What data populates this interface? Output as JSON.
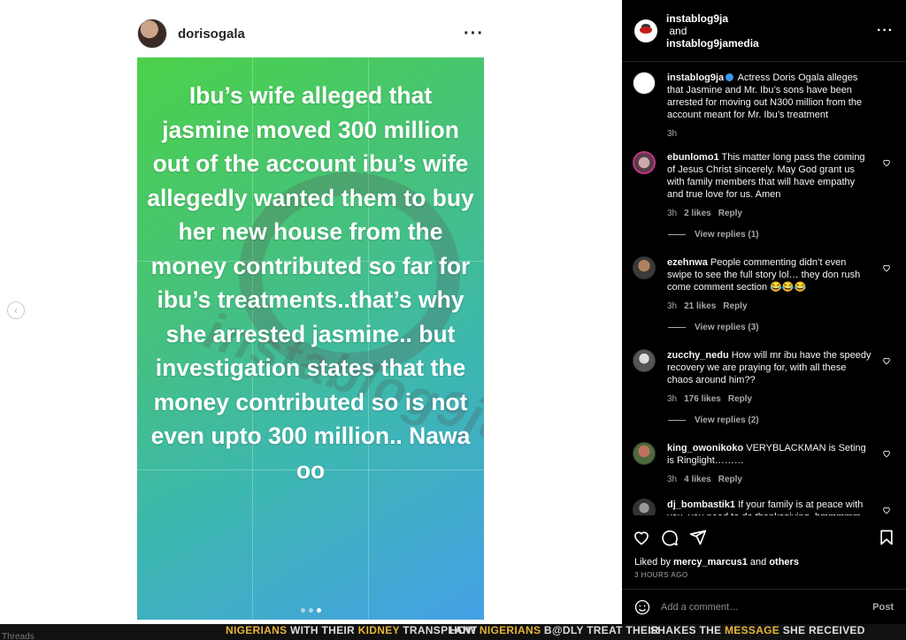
{
  "post": {
    "username": "dorisogala",
    "image_text": "Ibu’s wife alleged that jasmine moved 300 million out of the account ibu’s wife allegedly wanted them to buy her new house from the money contributed so far for ibu’s treatments..that’s why she arrested jasmine.. but investigation states that the money contributed so is not even upto 300 million.. Nawa oo",
    "watermark": "instablog9ja",
    "carousel": {
      "count": 3,
      "active": 3
    }
  },
  "panel": {
    "account1": "instablog9ja",
    "and": "and",
    "account2": "instablog9jamedia"
  },
  "caption": {
    "user": "instablog9ja",
    "text": "Actress Doris Ogala alleges that Jasmine and Mr. Ibu’s sons have been arrested for moving out N300 million from the account meant for Mr. Ibu’s treatment",
    "time": "3h"
  },
  "comments": [
    {
      "user": "ebunlomo1",
      "text": "This matter long pass the coming of Jesus Christ sincerely. May God grant us with family members that will have empathy and true love for us. Amen",
      "time": "3h",
      "likes": "2 likes",
      "reply": "Reply",
      "replies": "View replies (1)"
    },
    {
      "user": "ezehnwa",
      "text": "People commenting didn’t even swipe to see the full story lol… they don rush come comment section 😂😂😂",
      "time": "3h",
      "likes": "21 likes",
      "reply": "Reply",
      "replies": "View replies (3)"
    },
    {
      "user": "zucchy_nedu",
      "text": "How will mr ibu have the speedy recovery we are praying for, with all these chaos around him??",
      "time": "3h",
      "likes": "176 likes",
      "reply": "Reply",
      "replies": "View replies (2)"
    },
    {
      "user": "king_owonikoko",
      "text": "VERYBLACKMAN is Seting is Ringlight………",
      "time": "3h",
      "likes": "4 likes",
      "reply": "Reply"
    },
    {
      "user": "dj_bombastik1",
      "text": "If your family is at peace with you, you need to do thanksgiving, hmmmmm"
    }
  ],
  "actions": {
    "liked_prefix": "Liked by",
    "liked_user": "mercy_marcus1",
    "liked_and": "and",
    "liked_others": "others",
    "time_ago": "3 HOURS AGO",
    "add_comment_placeholder": "Add a comment…",
    "post_label": "Post"
  },
  "background": {
    "threads": "Threads",
    "ticker1_a": "NIGERIANS",
    "ticker1_b": "WITH THEIR",
    "ticker1_c": "KIDNEY",
    "ticker1_d": "TRANSPLANT",
    "ticker2_a": "HOW",
    "ticker2_b": "NIGERIANS",
    "ticker2_c": "B@DLY TREAT THEIR",
    "ticker3_a": "SHAKES THE",
    "ticker3_b": "MESSAGE",
    "ticker3_c": "SHE RECEIVED"
  },
  "colors": {
    "accent_blue": "#3897f0",
    "highlight": "#e6b43a"
  }
}
